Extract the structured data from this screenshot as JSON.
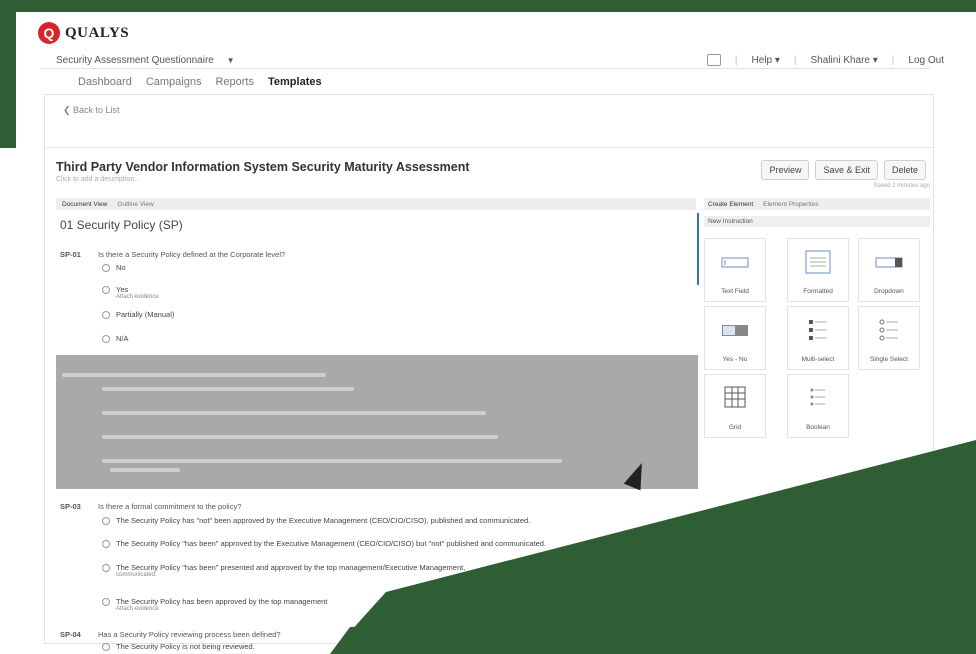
{
  "brand": {
    "name": "QUALYS",
    "mark": "Q"
  },
  "header": {
    "module_label": "Security Assessment Questionnaire",
    "top_links": [
      "Help ▾",
      "Shalini Khare ▾",
      "Log Out"
    ]
  },
  "nav": {
    "tabs": [
      "Dashboard",
      "Campaigns",
      "Reports",
      "Templates"
    ],
    "active": "Templates"
  },
  "back_link": "❮ Back to List",
  "page": {
    "title": "Third Party Vendor Information System Security Maturity Assessment",
    "subtitle": "Click to add a description...",
    "saved_note": "Saved 2 minutes ago",
    "buttons": {
      "preview": "Preview",
      "save_exit": "Save & Exit",
      "delete": "Delete"
    }
  },
  "doc_tabs": [
    "Document View",
    "Outline View"
  ],
  "section": {
    "title": "01 Security Policy (SP)"
  },
  "questions": [
    {
      "code": "SP-01",
      "text": "Is there a Security Policy defined at the Corporate level?",
      "options": [
        {
          "label": "No"
        },
        {
          "label": "Yes",
          "sub": "Attach evidence"
        },
        {
          "label": "Partially (Manual)"
        },
        {
          "label": "N/A"
        }
      ]
    },
    {
      "code": "SP-03",
      "text": "Is there a formal commitment to the policy?",
      "options": [
        {
          "label": "The Security Policy has \"not\" been approved by the Executive Management (CEO/CIO/CISO), published and communicated."
        },
        {
          "label": "The Security Policy \"has been\" approved by the Executive Management (CEO/CIO/CISO) but \"not\" published and communicated."
        },
        {
          "label": "The Security Policy \"has been\" presented and approved by the top management/Executive Management,",
          "sub": "communicated."
        },
        {
          "label": "The Security Policy has been approved by the top management",
          "sub": "Attach evidence"
        }
      ]
    },
    {
      "code": "SP-04",
      "text": "Has a Security Policy reviewing process been defined?",
      "options": [
        {
          "label": "The Security Policy is not being reviewed."
        }
      ]
    }
  ],
  "palette": {
    "tabs": [
      "Create Element",
      "Element Properties"
    ],
    "heading": "New Instruction",
    "tiles": [
      {
        "label": "Text Field",
        "icon": "text-field-icon"
      },
      {
        "label": "Formatted",
        "icon": "formatted-text-icon"
      },
      {
        "label": "Dropdown",
        "icon": "dropdown-icon"
      },
      {
        "label": "Yes - No",
        "icon": "yes-no-toggle-icon"
      },
      {
        "label": "Multi-select",
        "icon": "multi-select-icon"
      },
      {
        "label": "Single Select",
        "icon": "single-select-icon"
      },
      {
        "label": "Grid",
        "icon": "grid-icon"
      },
      {
        "label": "Boolean",
        "icon": "boolean-icon"
      }
    ]
  },
  "colors": {
    "frame": "#2f5e34",
    "brand": "#d6262b",
    "highlight": "#a9a9a9",
    "accent": "#3a6fb0"
  }
}
